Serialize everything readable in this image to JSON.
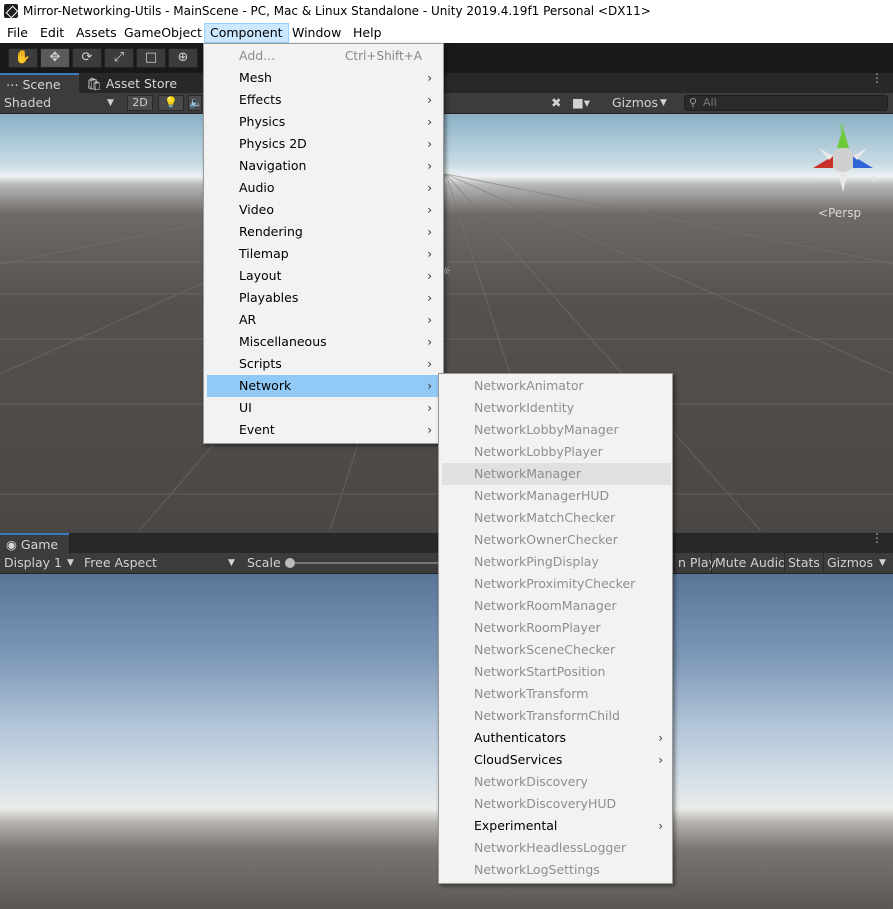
{
  "window": {
    "title": "Mirror-Networking-Utils - MainScene - PC, Mac & Linux Standalone - Unity 2019.4.19f1 Personal <DX11>"
  },
  "menubar": [
    "File",
    "Edit",
    "Assets",
    "GameObject",
    "Component",
    "Window",
    "Help"
  ],
  "scene_panel": {
    "tabs": [
      "Scene",
      "Asset Store"
    ],
    "shading_mode": "Shaded",
    "mode_2d": "2D",
    "gizmos_label": "Gizmos",
    "search_placeholder": "All",
    "persp_label": "Persp",
    "axis_x": "x",
    "axis_y": "y",
    "axis_z": "z"
  },
  "game_panel": {
    "tab": "Game",
    "display": "Display 1",
    "aspect": "Free Aspect",
    "scale_label": "Scale",
    "maximize_label": "n Play",
    "mute_audio": "Mute Audio",
    "stats": "Stats",
    "gizmos": "Gizmos"
  },
  "component_menu": [
    {
      "label": "Add...",
      "shortcut": "Ctrl+Shift+A",
      "disabled": true,
      "submenu": false
    },
    {
      "label": "Mesh",
      "submenu": true
    },
    {
      "label": "Effects",
      "submenu": true
    },
    {
      "label": "Physics",
      "submenu": true
    },
    {
      "label": "Physics 2D",
      "submenu": true
    },
    {
      "label": "Navigation",
      "submenu": true
    },
    {
      "label": "Audio",
      "submenu": true
    },
    {
      "label": "Video",
      "submenu": true
    },
    {
      "label": "Rendering",
      "submenu": true
    },
    {
      "label": "Tilemap",
      "submenu": true
    },
    {
      "label": "Layout",
      "submenu": true
    },
    {
      "label": "Playables",
      "submenu": true
    },
    {
      "label": "AR",
      "submenu": true
    },
    {
      "label": "Miscellaneous",
      "submenu": true
    },
    {
      "label": "Scripts",
      "submenu": true
    },
    {
      "label": "Network",
      "submenu": true,
      "highlighted": true
    },
    {
      "label": "UI",
      "submenu": true
    },
    {
      "label": "Event",
      "submenu": true
    }
  ],
  "network_menu": [
    {
      "label": "NetworkAnimator",
      "disabled": true
    },
    {
      "label": "NetworkIdentity",
      "disabled": true
    },
    {
      "label": "NetworkLobbyManager",
      "disabled": true
    },
    {
      "label": "NetworkLobbyPlayer",
      "disabled": true
    },
    {
      "label": "NetworkManager",
      "disabled": true,
      "hover": true
    },
    {
      "label": "NetworkManagerHUD",
      "disabled": true
    },
    {
      "label": "NetworkMatchChecker",
      "disabled": true
    },
    {
      "label": "NetworkOwnerChecker",
      "disabled": true
    },
    {
      "label": "NetworkPingDisplay",
      "disabled": true
    },
    {
      "label": "NetworkProximityChecker",
      "disabled": true
    },
    {
      "label": "NetworkRoomManager",
      "disabled": true
    },
    {
      "label": "NetworkRoomPlayer",
      "disabled": true
    },
    {
      "label": "NetworkSceneChecker",
      "disabled": true
    },
    {
      "label": "NetworkStartPosition",
      "disabled": true
    },
    {
      "label": "NetworkTransform",
      "disabled": true
    },
    {
      "label": "NetworkTransformChild",
      "disabled": true
    },
    {
      "label": "Authenticators",
      "submenu": true
    },
    {
      "label": "CloudServices",
      "submenu": true
    },
    {
      "label": "NetworkDiscovery",
      "disabled": true
    },
    {
      "label": "NetworkDiscoveryHUD",
      "disabled": true
    },
    {
      "label": "Experimental",
      "submenu": true
    },
    {
      "label": "NetworkHeadlessLogger",
      "disabled": true
    },
    {
      "label": "NetworkLogSettings",
      "disabled": true
    }
  ]
}
